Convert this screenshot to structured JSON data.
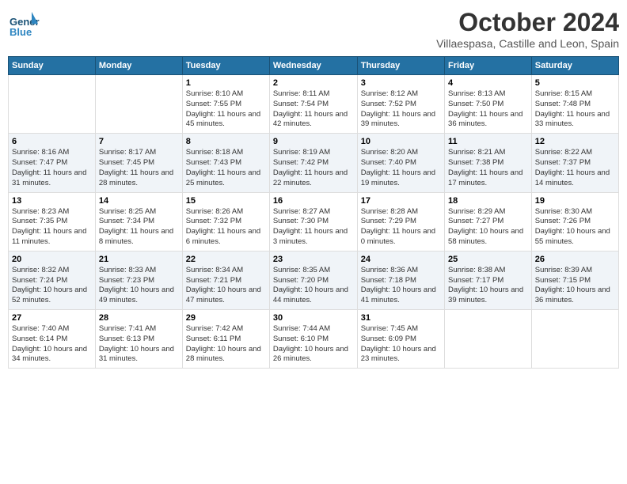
{
  "header": {
    "logo_general": "General",
    "logo_blue": "Blue",
    "title": "October 2024",
    "subtitle": "Villaespasa, Castille and Leon, Spain"
  },
  "weekdays": [
    "Sunday",
    "Monday",
    "Tuesday",
    "Wednesday",
    "Thursday",
    "Friday",
    "Saturday"
  ],
  "weeks": [
    [
      {
        "day": "",
        "info": ""
      },
      {
        "day": "",
        "info": ""
      },
      {
        "day": "1",
        "info": "Sunrise: 8:10 AM\nSunset: 7:55 PM\nDaylight: 11 hours and 45 minutes."
      },
      {
        "day": "2",
        "info": "Sunrise: 8:11 AM\nSunset: 7:54 PM\nDaylight: 11 hours and 42 minutes."
      },
      {
        "day": "3",
        "info": "Sunrise: 8:12 AM\nSunset: 7:52 PM\nDaylight: 11 hours and 39 minutes."
      },
      {
        "day": "4",
        "info": "Sunrise: 8:13 AM\nSunset: 7:50 PM\nDaylight: 11 hours and 36 minutes."
      },
      {
        "day": "5",
        "info": "Sunrise: 8:15 AM\nSunset: 7:48 PM\nDaylight: 11 hours and 33 minutes."
      }
    ],
    [
      {
        "day": "6",
        "info": "Sunrise: 8:16 AM\nSunset: 7:47 PM\nDaylight: 11 hours and 31 minutes."
      },
      {
        "day": "7",
        "info": "Sunrise: 8:17 AM\nSunset: 7:45 PM\nDaylight: 11 hours and 28 minutes."
      },
      {
        "day": "8",
        "info": "Sunrise: 8:18 AM\nSunset: 7:43 PM\nDaylight: 11 hours and 25 minutes."
      },
      {
        "day": "9",
        "info": "Sunrise: 8:19 AM\nSunset: 7:42 PM\nDaylight: 11 hours and 22 minutes."
      },
      {
        "day": "10",
        "info": "Sunrise: 8:20 AM\nSunset: 7:40 PM\nDaylight: 11 hours and 19 minutes."
      },
      {
        "day": "11",
        "info": "Sunrise: 8:21 AM\nSunset: 7:38 PM\nDaylight: 11 hours and 17 minutes."
      },
      {
        "day": "12",
        "info": "Sunrise: 8:22 AM\nSunset: 7:37 PM\nDaylight: 11 hours and 14 minutes."
      }
    ],
    [
      {
        "day": "13",
        "info": "Sunrise: 8:23 AM\nSunset: 7:35 PM\nDaylight: 11 hours and 11 minutes."
      },
      {
        "day": "14",
        "info": "Sunrise: 8:25 AM\nSunset: 7:34 PM\nDaylight: 11 hours and 8 minutes."
      },
      {
        "day": "15",
        "info": "Sunrise: 8:26 AM\nSunset: 7:32 PM\nDaylight: 11 hours and 6 minutes."
      },
      {
        "day": "16",
        "info": "Sunrise: 8:27 AM\nSunset: 7:30 PM\nDaylight: 11 hours and 3 minutes."
      },
      {
        "day": "17",
        "info": "Sunrise: 8:28 AM\nSunset: 7:29 PM\nDaylight: 11 hours and 0 minutes."
      },
      {
        "day": "18",
        "info": "Sunrise: 8:29 AM\nSunset: 7:27 PM\nDaylight: 10 hours and 58 minutes."
      },
      {
        "day": "19",
        "info": "Sunrise: 8:30 AM\nSunset: 7:26 PM\nDaylight: 10 hours and 55 minutes."
      }
    ],
    [
      {
        "day": "20",
        "info": "Sunrise: 8:32 AM\nSunset: 7:24 PM\nDaylight: 10 hours and 52 minutes."
      },
      {
        "day": "21",
        "info": "Sunrise: 8:33 AM\nSunset: 7:23 PM\nDaylight: 10 hours and 49 minutes."
      },
      {
        "day": "22",
        "info": "Sunrise: 8:34 AM\nSunset: 7:21 PM\nDaylight: 10 hours and 47 minutes."
      },
      {
        "day": "23",
        "info": "Sunrise: 8:35 AM\nSunset: 7:20 PM\nDaylight: 10 hours and 44 minutes."
      },
      {
        "day": "24",
        "info": "Sunrise: 8:36 AM\nSunset: 7:18 PM\nDaylight: 10 hours and 41 minutes."
      },
      {
        "day": "25",
        "info": "Sunrise: 8:38 AM\nSunset: 7:17 PM\nDaylight: 10 hours and 39 minutes."
      },
      {
        "day": "26",
        "info": "Sunrise: 8:39 AM\nSunset: 7:15 PM\nDaylight: 10 hours and 36 minutes."
      }
    ],
    [
      {
        "day": "27",
        "info": "Sunrise: 7:40 AM\nSunset: 6:14 PM\nDaylight: 10 hours and 34 minutes."
      },
      {
        "day": "28",
        "info": "Sunrise: 7:41 AM\nSunset: 6:13 PM\nDaylight: 10 hours and 31 minutes."
      },
      {
        "day": "29",
        "info": "Sunrise: 7:42 AM\nSunset: 6:11 PM\nDaylight: 10 hours and 28 minutes."
      },
      {
        "day": "30",
        "info": "Sunrise: 7:44 AM\nSunset: 6:10 PM\nDaylight: 10 hours and 26 minutes."
      },
      {
        "day": "31",
        "info": "Sunrise: 7:45 AM\nSunset: 6:09 PM\nDaylight: 10 hours and 23 minutes."
      },
      {
        "day": "",
        "info": ""
      },
      {
        "day": "",
        "info": ""
      }
    ]
  ]
}
